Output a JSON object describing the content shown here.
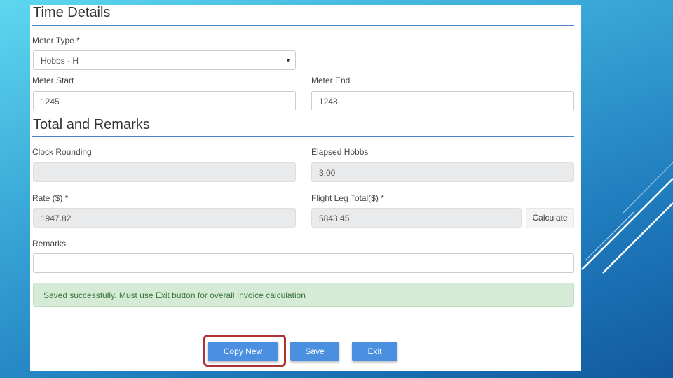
{
  "time_details": {
    "title": "Time Details",
    "meter_type_label": "Meter Type *",
    "meter_type_value": "Hobbs - H",
    "meter_start_label": "Meter Start",
    "meter_start_value": "1245",
    "meter_end_label": "Meter End",
    "meter_end_value": "1248"
  },
  "totals": {
    "title": "Total and Remarks",
    "clock_rounding_label": "Clock Rounding",
    "clock_rounding_value": "",
    "elapsed_label": "Elapsed Hobbs",
    "elapsed_value": "3.00",
    "rate_label": "Rate ($) *",
    "rate_value": "1947.82",
    "flight_leg_total_label": "Flight Leg Total($) *",
    "flight_leg_total_value": "5843.45",
    "calculate_label": "Calculate",
    "remarks_label": "Remarks",
    "remarks_value": ""
  },
  "alert": {
    "message": "Saved successfully. Must use Exit button for overall Invoice calculation"
  },
  "actions": {
    "copy_new_label": "Copy New",
    "save_label": "Save",
    "exit_label": "Exit"
  },
  "colors": {
    "accent": "#4a8fe0",
    "section_rule": "#4a86c8",
    "success_bg": "#d6ebd6",
    "highlight": "#b13232"
  }
}
